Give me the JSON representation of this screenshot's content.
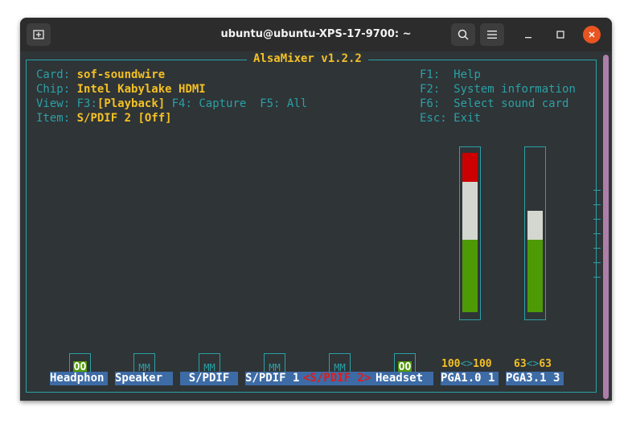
{
  "window": {
    "title": "ubuntu@ubuntu-XPS-17-9700: ~",
    "buttons": {
      "new_tab_icon": "new-tab-icon",
      "search_icon": "search-icon",
      "menu_icon": "hamburger-menu-icon"
    },
    "controls": {
      "minimize": "—",
      "maximize": "☐",
      "close": "✕"
    }
  },
  "alsamixer": {
    "title": "AlsaMixer v1.2.2",
    "card_label": "Card:",
    "card_value": "sof-soundwire",
    "chip_label": "Chip:",
    "chip_value": "Intel Kabylake HDMI",
    "view_label": "View:",
    "view_f3": "F3:",
    "view_playback": "[Playback]",
    "view_f4": "F4: Capture",
    "view_f5": "F5: All",
    "item_label": "Item:",
    "item_value": "S/PDIF 2 [Off]",
    "help": [
      {
        "key": "F1:",
        "text": "Help"
      },
      {
        "key": "F2:",
        "text": "System information"
      },
      {
        "key": "F6:",
        "text": "Select sound card"
      },
      {
        "key": "Esc:",
        "text": "Exit"
      }
    ]
  },
  "controls": [
    {
      "name": "Headphon",
      "mute": "OO",
      "active": true
    },
    {
      "name": "Speaker",
      "mute": "MM",
      "active": false
    },
    {
      "name": "S/PDIF",
      "mute": "MM",
      "active": false
    },
    {
      "name": "S/PDIF 1",
      "mute": "MM",
      "active": false
    },
    {
      "name": "<S/PDIF 2>",
      "mute": "MM",
      "active": false,
      "selected": true
    },
    {
      "name": "Headset",
      "mute": "OO",
      "active": true
    },
    {
      "name": "PGA1.0 1",
      "volume": "100<>100",
      "level_percent": 100
    },
    {
      "name": "PGA3.1 3",
      "volume": "63<>63",
      "level_percent": 63
    }
  ],
  "colors": {
    "teal": "#2aa1a6",
    "yellow": "#f3c024",
    "green": "#4e9a06",
    "white": "#d3d7cf",
    "red": "#cc0000",
    "label_bg": "#3d6ba5"
  }
}
